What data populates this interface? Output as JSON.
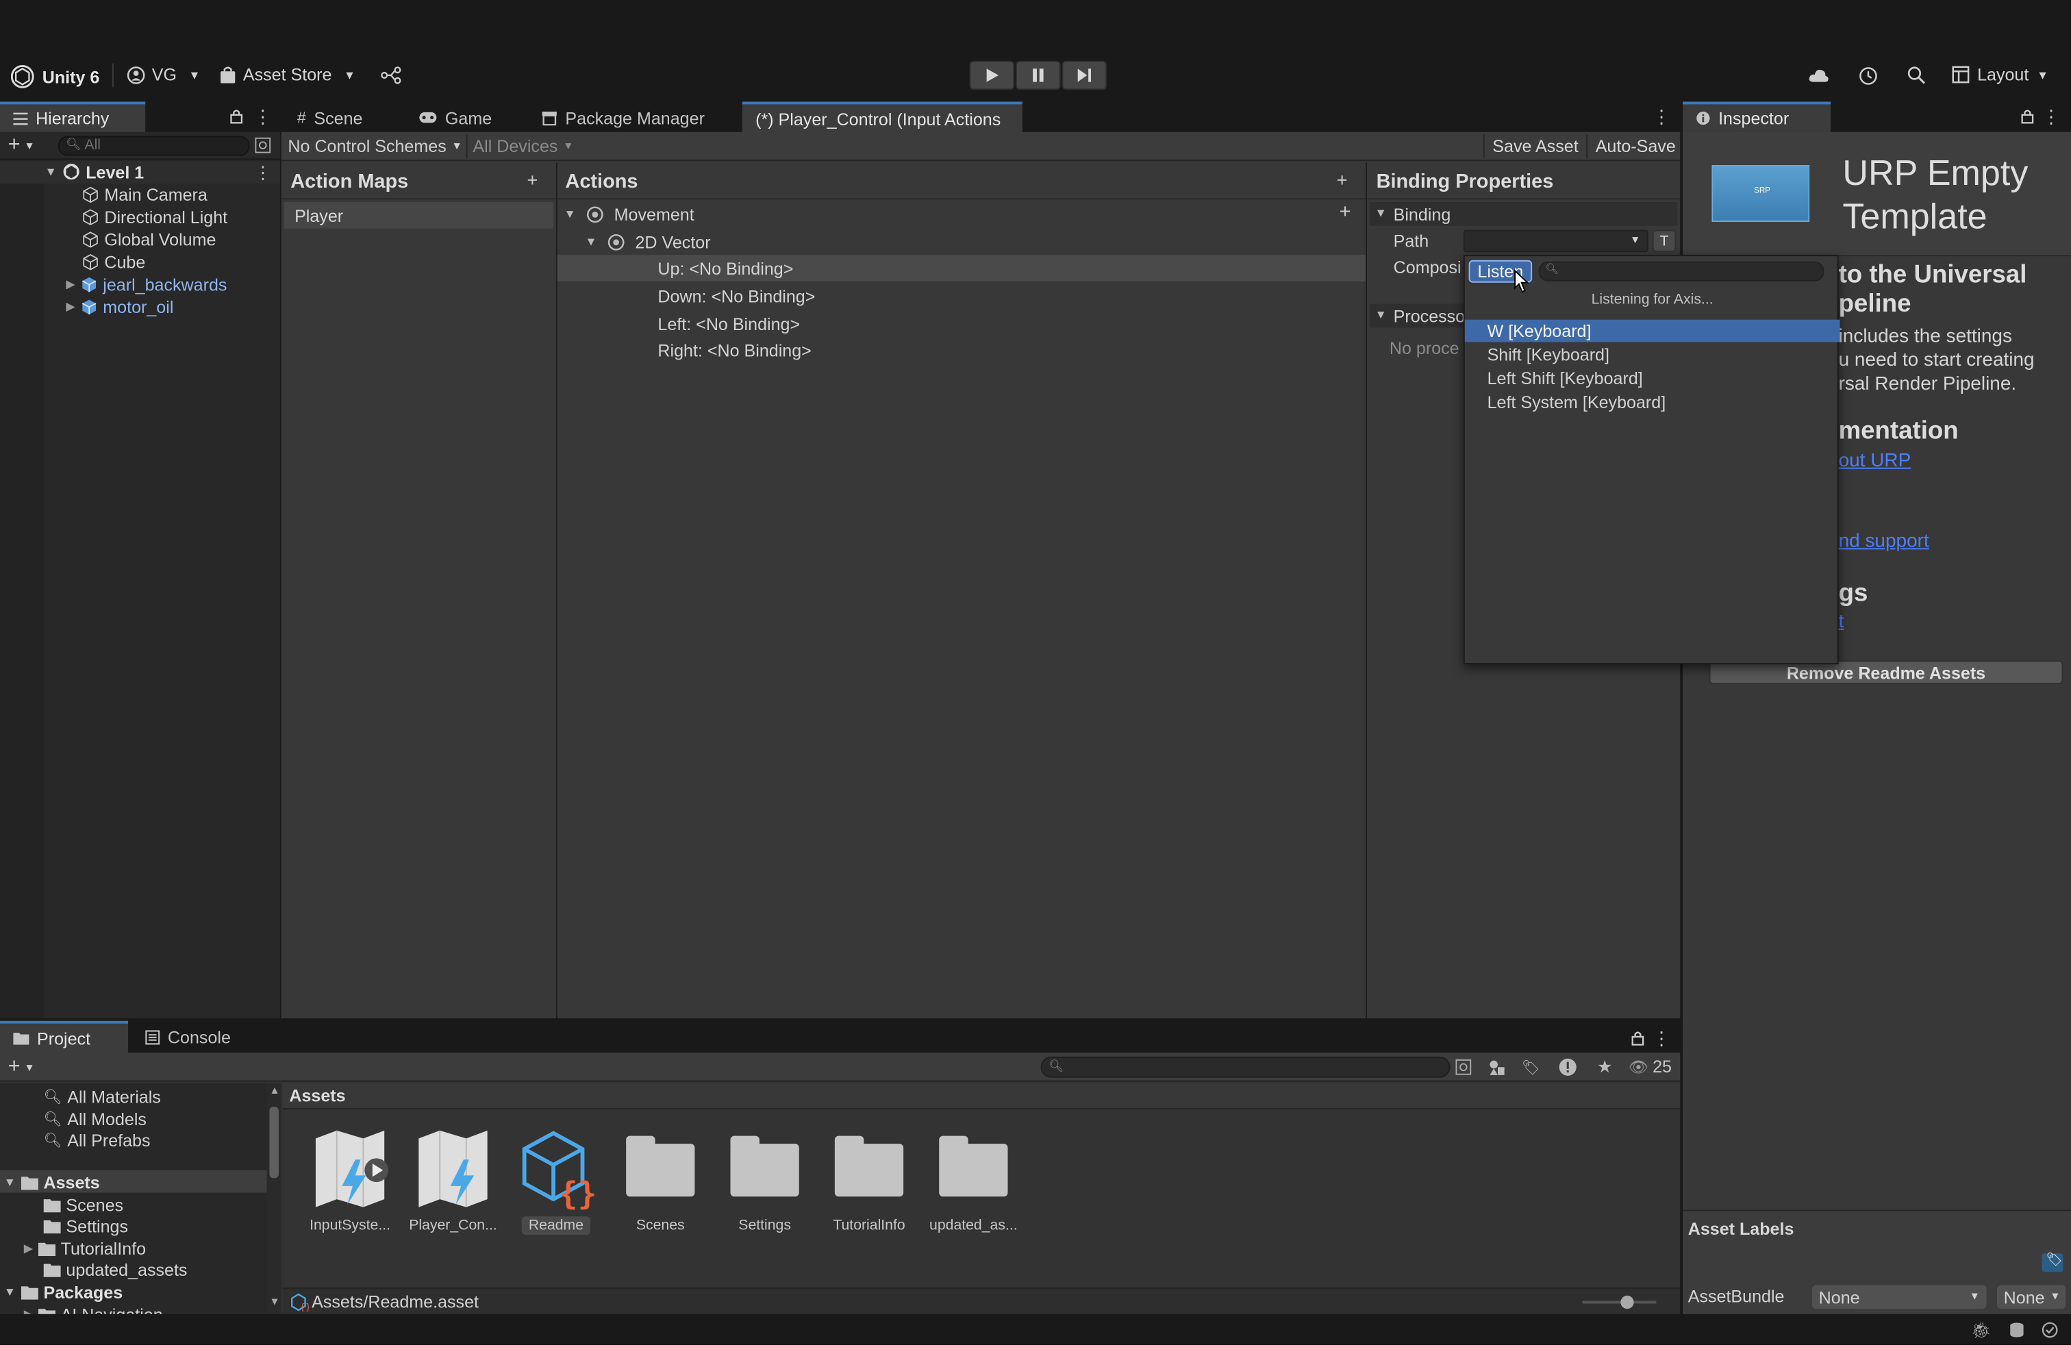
{
  "toolbar": {
    "unity_label": "Unity 6",
    "account_label": "VG",
    "asset_store_label": "Asset Store",
    "layout_label": "Layout"
  },
  "hierarchy": {
    "tab_label": "Hierarchy",
    "search_placeholder": "All",
    "scene_name": "Level 1",
    "items": [
      {
        "label": "Main Camera",
        "type": "gameobject"
      },
      {
        "label": "Directional Light",
        "type": "gameobject"
      },
      {
        "label": "Global Volume",
        "type": "gameobject"
      },
      {
        "label": "Cube",
        "type": "gameobject"
      },
      {
        "label": "jearl_backwards",
        "type": "prefab"
      },
      {
        "label": "motor_oil",
        "type": "prefab"
      }
    ]
  },
  "center_tabs": {
    "scene": "Scene",
    "game": "Game",
    "package_manager": "Package Manager",
    "input_actions": "(*) Player_Control (Input Actions"
  },
  "input_actions": {
    "control_schemes": "No Control Schemes",
    "devices": "All Devices",
    "save_asset": "Save Asset",
    "auto_save": "Auto-Save",
    "action_maps_title": "Action Maps",
    "action_maps": [
      "Player"
    ],
    "actions_title": "Actions",
    "action": "Movement",
    "composite": "2D Vector",
    "bindings": [
      "Up: <No Binding>",
      "Down: <No Binding>",
      "Left: <No Binding>",
      "Right: <No Binding>"
    ],
    "binding_properties_title": "Binding Properties",
    "binding_section": "Binding",
    "path_label": "Path",
    "composite_label": "Composi",
    "processors_label": "Processo",
    "no_processors": "No proce",
    "t_button": "T"
  },
  "dropdown": {
    "listen_button": "Listen",
    "status": "Listening for Axis...",
    "options": [
      "W [Keyboard]",
      "Shift [Keyboard]",
      "Left Shift [Keyboard]",
      "Left System [Keyboard]"
    ],
    "selected_index": 0
  },
  "inspector": {
    "tab_label": "Inspector",
    "title": "URP Empty Template",
    "thumb_text": "SRP",
    "heading1": "to the Universal",
    "heading1b": "peline",
    "body_lines": [
      "includes the settings",
      "u need to start creating",
      "rsal Render Pipeline."
    ],
    "heading2": "mentation",
    "link1": "out URP",
    "link2": "nd support",
    "heading3": "gs",
    "link3": "t",
    "remove_button": "Remove Readme Assets",
    "asset_labels": "Asset Labels",
    "assetbundle_label": "AssetBundle",
    "assetbundle_value": "None",
    "variant_value": "None"
  },
  "project": {
    "tab_project": "Project",
    "tab_console": "Console",
    "search_count": "25",
    "favorites": [
      "All Materials",
      "All Models",
      "All Prefabs"
    ],
    "assets_root": "Assets",
    "asset_folders": [
      "Scenes",
      "Settings",
      "TutorialInfo",
      "updated_assets"
    ],
    "packages_root": "Packages",
    "packages_partial": "AI Navigation",
    "breadcrumb": "Assets",
    "assets": [
      "InputSyste...",
      "Player_Con...",
      "Readme",
      "Scenes",
      "Settings",
      "TutorialInfo",
      "updated_as..."
    ],
    "footer_path": "Assets/Readme.asset"
  },
  "colors": {
    "accent": "#3a79bb",
    "selection": "#2c5d87",
    "link": "#4c7fff",
    "dropdown_selected": "#3d69a8"
  }
}
